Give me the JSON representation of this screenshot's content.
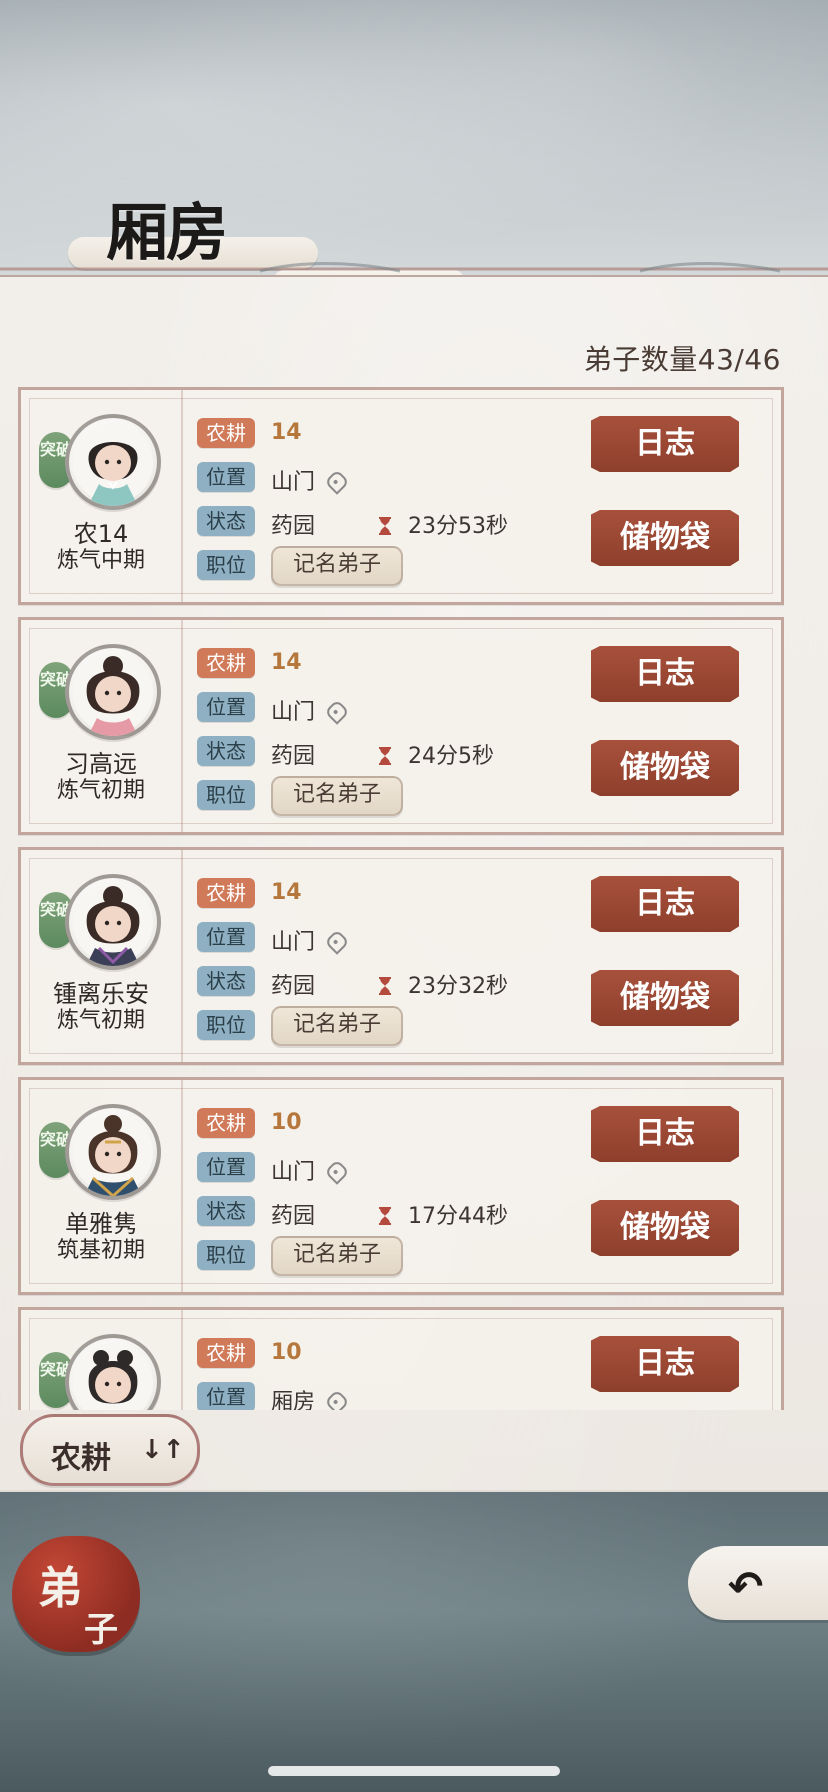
{
  "screen": {
    "title": "厢房",
    "disciple_count_label": "弟子数量43/46"
  },
  "cards": [
    {
      "name": "农14",
      "realm": "炼气中期",
      "break_badge": "突破",
      "skill_tag": "农耕",
      "skill_value": "14",
      "location_label": "位置",
      "location_value": "山门",
      "status_label": "状态",
      "status_value": "药园",
      "timer_value": "23分53秒",
      "rank_label": "职位",
      "rank_value": "记名弟子",
      "log_button": "日志",
      "bag_button": "储物袋"
    },
    {
      "name": "习高远",
      "realm": "炼气初期",
      "break_badge": "突破",
      "skill_tag": "农耕",
      "skill_value": "14",
      "location_label": "位置",
      "location_value": "山门",
      "status_label": "状态",
      "status_value": "药园",
      "timer_value": "24分5秒",
      "rank_label": "职位",
      "rank_value": "记名弟子",
      "log_button": "日志",
      "bag_button": "储物袋"
    },
    {
      "name": "锺离乐安",
      "realm": "炼气初期",
      "break_badge": "突破",
      "skill_tag": "农耕",
      "skill_value": "14",
      "location_label": "位置",
      "location_value": "山门",
      "status_label": "状态",
      "status_value": "药园",
      "timer_value": "23分32秒",
      "rank_label": "职位",
      "rank_value": "记名弟子",
      "log_button": "日志",
      "bag_button": "储物袋"
    },
    {
      "name": "单雅隽",
      "realm": "筑基初期",
      "break_badge": "突破",
      "skill_tag": "农耕",
      "skill_value": "10",
      "location_label": "位置",
      "location_value": "山门",
      "status_label": "状态",
      "status_value": "药园",
      "timer_value": "17分44秒",
      "rank_label": "职位",
      "rank_value": "记名弟子",
      "log_button": "日志",
      "bag_button": "储物袋"
    },
    {
      "break_badge": "突破",
      "skill_tag": "农耕",
      "skill_value": "10",
      "location_label": "位置",
      "location_value": "厢房",
      "log_button": "日志"
    }
  ],
  "sort": {
    "label": "农耕",
    "arrows": "↓↑"
  },
  "bottom_tabs": {
    "disciple_main": "弟",
    "disciple_sub": "子"
  },
  "icons": {
    "location": "location-pin-icon",
    "timer": "hourglass-icon",
    "back": "back-arrow-icon"
  },
  "colors": {
    "accent_red": "#9a4633",
    "skill_orange": "#d07a59",
    "info_blue": "#8fb0c2",
    "break_green": "#6d9a6b"
  }
}
